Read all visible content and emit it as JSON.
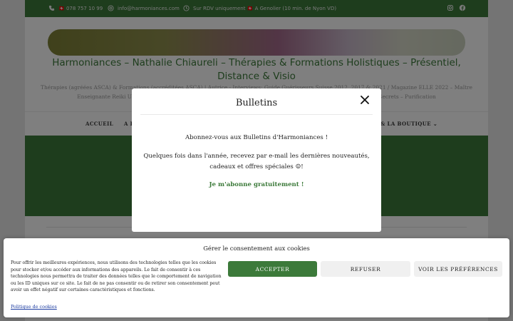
{
  "topbar": {
    "phone": "🇨🇭 078 757 10 99",
    "email": "info@harmoniances.com",
    "hours": "Sur RDV uniquement 🇨🇭 A Genolier (10 min. de Nyon VD)",
    "icons": [
      "phone-icon",
      "at-icon",
      "clock-icon",
      "instagram-icon",
      "facebook-icon"
    ]
  },
  "header": {
    "site_title": "Harmoniances – Nathalie Chiaureli – Thérapies & Formations Holistiques – Présentiel, Distance & Visio",
    "tagline": "Thérapies (agréées ASCA) & Formations (accréditées ASCA) | Autrice - Interviews: Guide Guérisseurs Suisse 2012, 2017 & 2021 / Magazine ELLE 2022 – Maître Enseignante Reiki Usui et Karuna – Formatrice – Maîtresse Enseignante de Reiki de Haut Niveau – Conteuse de Secrets – Purification"
  },
  "nav": {
    "items": [
      "ACCUEIL",
      "A P",
      "& LA BOUTIQUE ⌄"
    ]
  },
  "modal": {
    "title": "Bulletins",
    "line1": "Abonnez-vous aux Bulletins d'Harmoniances !",
    "line2": "Quelques fois dans l'année, recevez par e-mail les dernières nouveautés,",
    "line3": "cadeaux et offres spéciales ☺!",
    "link": "Je m'abonne gratuitement !"
  },
  "cookie": {
    "title": "Gérer le consentement aux cookies",
    "text": "Pour offrir les meilleures expériences, nous utilisons des technologies telles que les cookies pour stocker et/ou accéder aux informations des appareils. Le fait de consentir à ces technologies nous permettra de traiter des données telles que le comportement de navigation ou les ID uniques sur ce site. Le fait de ne pas consentir ou de retirer son consentement peut avoir un effet négatif sur certaines caractéristiques et fonctions.",
    "accept": "ACCEPTER",
    "refuse": "REFUSER",
    "prefs": "VOIR LES PRÉFÉRENCES",
    "policy_link": "Politique de cookies"
  },
  "colors": {
    "brand_green": "#3c7a3a",
    "overlay": "rgba(0,0,0,0.5)"
  }
}
